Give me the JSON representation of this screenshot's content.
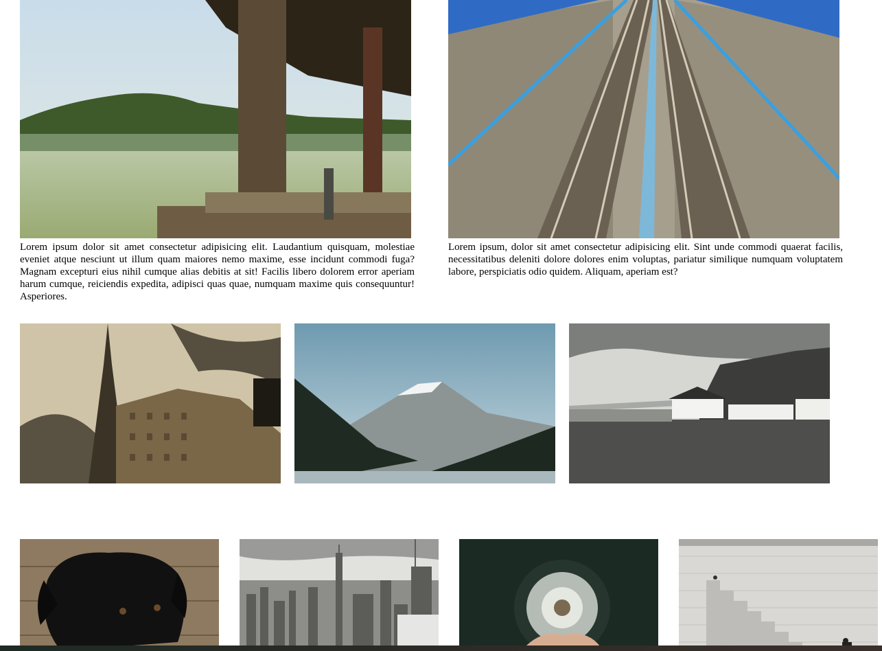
{
  "row1": [
    {
      "image": "lake-dock-photo",
      "caption": "Lorem ipsum dolor sit amet consectetur adipisicing elit. Laudantium quisquam, molestiae eveniet atque nesciunt ut illum quam maiores nemo maxime, esse incidunt commodi fuga? Magnam excepturi eius nihil cumque alias debitis at sit! Facilis libero dolorem error aperiam harum cumque, reiciendis expedita, adipisci quas quae, numquam maxime quis consequuntur! Asperiores."
    },
    {
      "image": "railway-tracks-photo",
      "caption": "Lorem ipsum, dolor sit amet consectetur adipisicing elit. Sint unde commodi quaerat facilis, necessitatibus deleniti dolore dolores enim voluptas, pariatur similique numquam voluptatem labore, perspiciatis odio quidem. Aliquam, aperiam est?"
    }
  ],
  "row2": [
    "eiffel-tower-photo",
    "mountain-lake-photo",
    "coastal-cottages-photo"
  ],
  "row3": [
    "black-puppy-photo",
    "city-skyline-photo",
    "dandelion-photo",
    "stone-stairs-photo"
  ],
  "colors": {
    "background": "#ffffff",
    "footer_bar": "#2b2a25"
  }
}
